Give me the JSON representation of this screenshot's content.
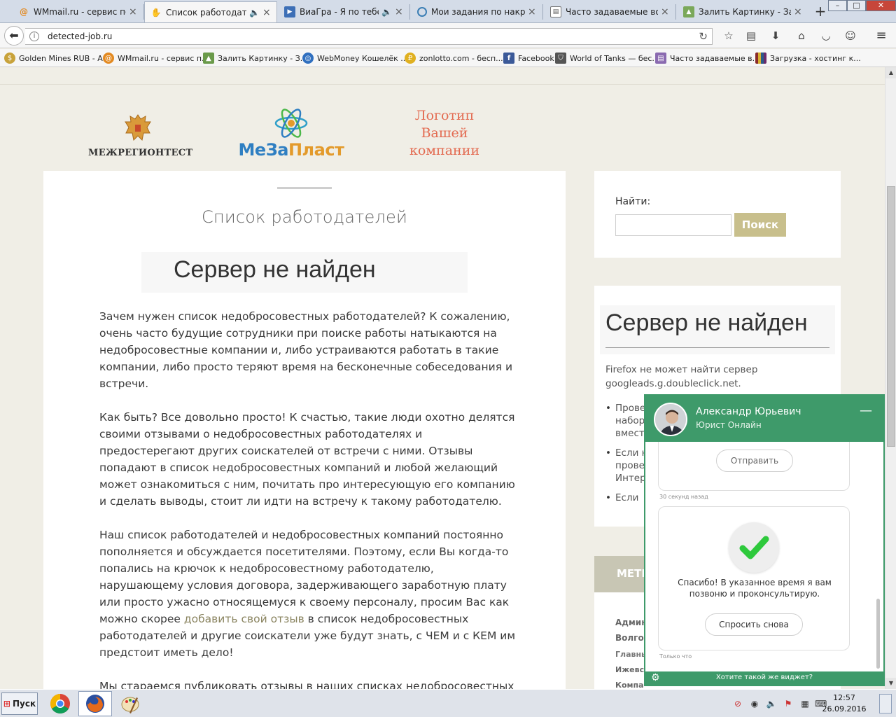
{
  "tabs": [
    {
      "label": "WMmail.ru - сервис почт...",
      "icon": "wmmail-icon"
    },
    {
      "label": "Список работодате...",
      "icon": "hand-icon",
      "active": true
    },
    {
      "label": "ВиаГра - Я по тебе ...",
      "icon": "video-play-icon"
    },
    {
      "label": "Мои задания по накрутке",
      "icon": "spiral-icon"
    },
    {
      "label": "Часто задаваемые вопр...",
      "icon": "faq-page-icon"
    },
    {
      "label": "Залить Картинку - Загр...",
      "icon": "image-upload-icon"
    }
  ],
  "window_controls": {
    "minimize": "–",
    "maximize": "□",
    "close": "✕"
  },
  "address_bar": {
    "url": "detected-job.ru"
  },
  "bookmarks": [
    {
      "label": "Golden Mines RUB - A...",
      "icon": "gold-coin-icon",
      "color": "#c8a23a"
    },
    {
      "label": "WMmail.ru - сервис п...",
      "icon": "wmmail-icon",
      "color": "#e38a22"
    },
    {
      "label": "Залить Картинку - З...",
      "icon": "image-upload-icon",
      "color": "#6a9a4a"
    },
    {
      "label": "WebMoney Кошелёк ...",
      "icon": "webmoney-icon",
      "color": "#2f6fbf"
    },
    {
      "label": "zonlotto.com - бесп...",
      "icon": "zonlotto-icon",
      "color": "#e0b020"
    },
    {
      "label": "Facebook",
      "icon": "facebook-icon",
      "color": "#3b5998"
    },
    {
      "label": "World of Tanks — бес...",
      "icon": "wot-shield-icon",
      "color": "#555555"
    },
    {
      "label": "Часто задаваемые в...",
      "icon": "faq-page-icon",
      "color": "#8a6ab0"
    },
    {
      "label": "Загрузка - хостинг к...",
      "icon": "hosting-icon",
      "color": "#8a2a2a"
    }
  ],
  "logos": {
    "logo1": "МЕЖРЕГИОНТЕСТ",
    "logo2_a": "МеЗа",
    "logo2_b": "Пласт",
    "logo3": "Логотип Вашей компании"
  },
  "main": {
    "title": "Список работодателей",
    "error_title": "Сервер не найден",
    "paragraph1": "Зачем нужен список недобросовестных работодателей? К сожалению, очень часто будущие сотрудники при поиске работы натыкаются на недобросовестные компании и, либо устраиваются работать в такие компании, либо просто теряют время на бесконечные собеседования и встречи.",
    "paragraph2": "Как быть? Все довольно просто! К счастью, такие люди охотно делятся своими отзывами о недобросовестных работодателях и предостерегают других соискателей от встречи с ними. Отзывы попадают в список недобросовестных компаний и любой желающий может ознакомиться с ним, почитать про интересующую его компанию и сделать выводы, стоит ли идти на встречу к такому работодателю.",
    "paragraph3_before": "Наш список работодателей и недобросовестных компаний постоянно пополняется и обсуждается посетителями. Поэтому, если Вы когда-то попались на крючок к недобросовестному работодателю, нарушающему условия договора, задерживающего заработную плату или просто ужасно относящемуся к своему персоналу, просим Вас как можно скорее ",
    "paragraph3_link": "добавить свой отзыв",
    "paragraph3_after": " в список недобросовестных работодателей и другие соискатели уже будут знать, с ЧЕМ и с КЕМ им предстоит иметь дело!",
    "paragraph4": "Мы стараемся публиковать отзывы в наших списках недобросовестных работодателей справедливо. Внимательно читаем отзыв, проверяем"
  },
  "search": {
    "label": "Найти:",
    "button": "Поиск",
    "value": ""
  },
  "sidebar_error": {
    "title": "Сервер не найден",
    "message": "Firefox не может найти сервер googleads.g.doubleclick.net.",
    "bullets": [
      "Прове набор вмест",
      "Если н прове Интер",
      "Если"
    ]
  },
  "sidebar_menu": {
    "header": "МЕТКИ",
    "items": [
      "Админ",
      "Волго",
      "Главны",
      "Ижевс",
      "Компа"
    ]
  },
  "chat": {
    "agent_name": "Александр Юрьевич",
    "agent_role": "Юрист Онлайн",
    "send_button": "Отправить",
    "time_ago": "30 секунд назад",
    "thanks_message": "Спасибо! В указанное время я вам позвоню и проконсультирую.",
    "ask_again_button": "Спросить снова",
    "just_now": "Только что",
    "footer_cta": "Хотите такой же виджет?",
    "accent_color": "#3e9a6a"
  },
  "taskbar": {
    "start_label": "Пуск",
    "apps": [
      "chrome-icon",
      "firefox-icon",
      "paint-icon"
    ],
    "time": "12:57",
    "date": "26.09.2016"
  }
}
